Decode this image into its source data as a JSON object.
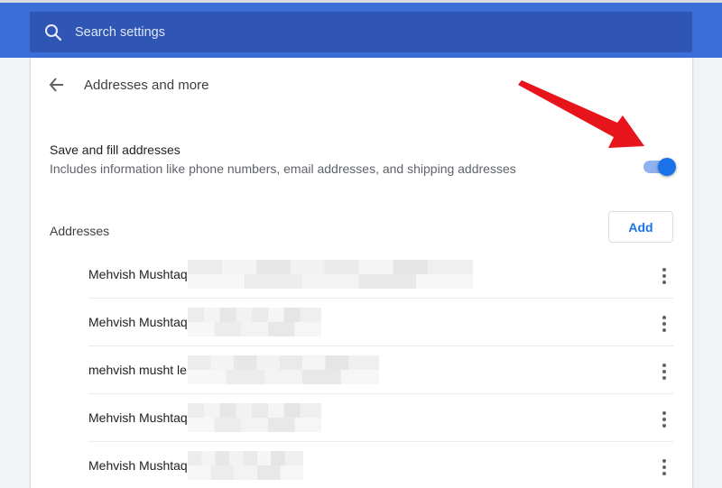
{
  "search": {
    "placeholder": "Search settings",
    "icon": "search-icon"
  },
  "header": {
    "title": "Addresses and more",
    "back_icon": "back-arrow-icon"
  },
  "setting": {
    "title": "Save and fill addresses",
    "description": "Includes information like phone numbers, email addresses, and shipping addresses",
    "enabled": true
  },
  "addresses": {
    "label": "Addresses",
    "add_label": "Add",
    "items": [
      {
        "name": "Mehvish Mushtaq"
      },
      {
        "name": "Mehvish Mushtaq"
      },
      {
        "name": "mehvish musht le"
      },
      {
        "name": "Mehvish Mushtaq"
      },
      {
        "name": "Mehvish Mushtaq"
      }
    ]
  },
  "colors": {
    "top_bar": "#3c6ed8",
    "search_box": "#2f56b5",
    "accent": "#1a73e8",
    "annotation_arrow": "#e8141c"
  }
}
